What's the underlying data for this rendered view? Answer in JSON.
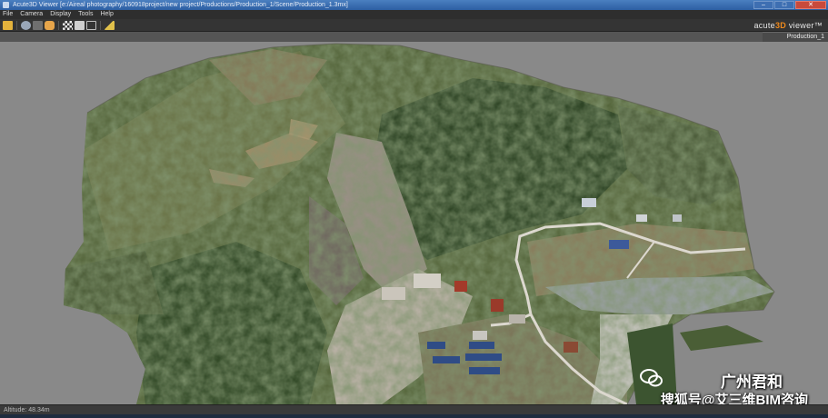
{
  "window": {
    "title": "Acute3D Viewer [e:/Aireal photography/160918project/new project/Productions/Production_1/Scene/Production_1.3mx]",
    "controls": [
      "–",
      "□",
      "✕"
    ]
  },
  "menu": [
    "File",
    "Camera",
    "Display",
    "Tools",
    "Help"
  ],
  "toolbar": {
    "buttons": [
      {
        "name": "open-folder-icon",
        "color": "#e3b23c"
      },
      {
        "name": "orbit-icon",
        "color": "#9aa7b8"
      },
      {
        "name": "camera-icon",
        "color": "#6f6f6f"
      },
      {
        "name": "pan-hand-icon",
        "color": "#e7a54a"
      },
      {
        "name": "checker-icon",
        "color": "#d8d8d8"
      },
      {
        "name": "select-icon",
        "color": "#cfcfcf"
      },
      {
        "name": "frame-icon",
        "color": "#bdbdbd"
      },
      {
        "name": "measure-icon",
        "color": "#e0c04a"
      }
    ]
  },
  "brand": {
    "prefix": "acute",
    "accent": "3D",
    "suffix": " viewer™"
  },
  "document_tab": "Production_1",
  "status": "Altitude: 48.34m",
  "watermark": {
    "line1": "广州君和",
    "line2": "搜狐号@艾三维BIM咨询"
  },
  "colors": {
    "viewport_bg": "#898989",
    "vegetation_dark": "#3a4a2a",
    "vegetation_mid": "#56663c",
    "soil": "#a18a6a",
    "rock": "#9a8f86",
    "road": "#d8d4cc",
    "roof_blue": "#2f4c86"
  }
}
